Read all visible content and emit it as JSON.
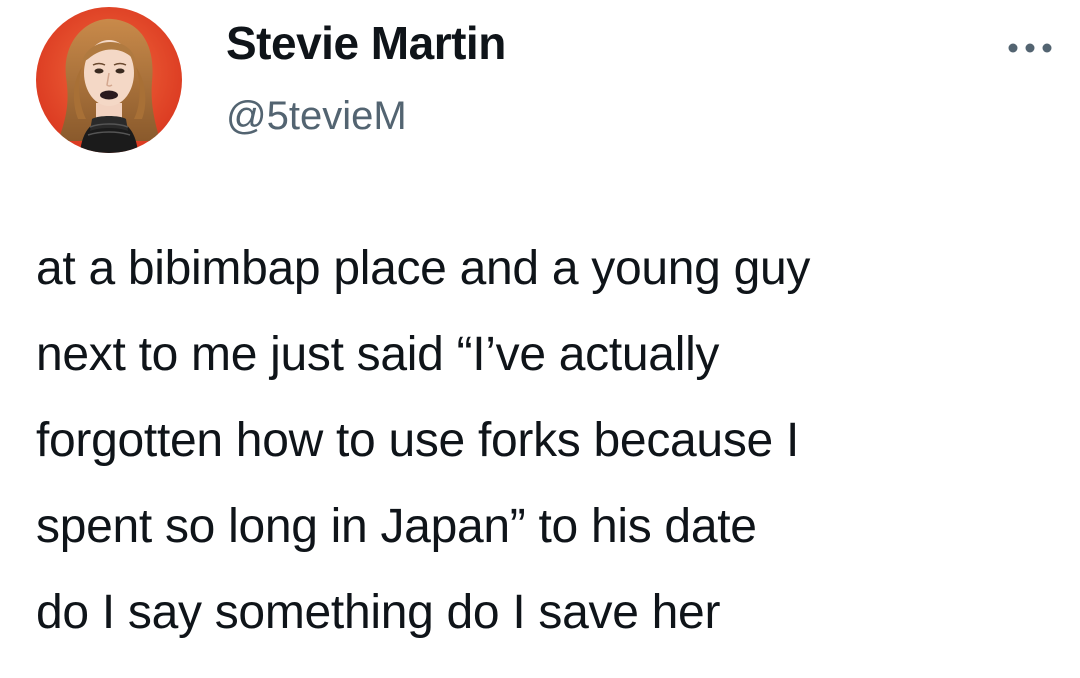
{
  "author": {
    "display_name": "Stevie Martin",
    "handle": "@5tevieM",
    "avatar_icon": "profile-photo",
    "avatar_ring_color": "#e8452c"
  },
  "menu": {
    "icon": "more-options-icon"
  },
  "tweet": {
    "lines": [
      "at a bibimbap place and a young guy",
      "next to me just said “I’ve actually",
      "forgotten how to use forks because I",
      "spent so long in Japan” to his date",
      "do I say something do I save her"
    ]
  }
}
